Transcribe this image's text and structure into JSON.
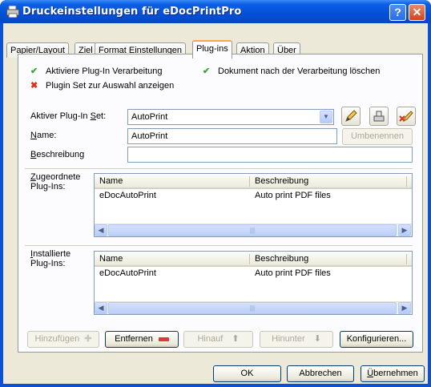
{
  "window": {
    "title": "Druckeinstellungen für eDocPrintPro",
    "help_label": "?",
    "close_label": "✕"
  },
  "tabs": [
    {
      "label": "Papier/Layout"
    },
    {
      "label": "Ziel"
    },
    {
      "label": "Format Einstellungen"
    },
    {
      "label": "Plug-ins"
    },
    {
      "label": "Aktion"
    },
    {
      "label": "Über"
    }
  ],
  "active_tab": "Plug-ins",
  "options": {
    "activate_plugin": {
      "label": "Aktiviere Plug-In Verarbeitung",
      "state": "checked"
    },
    "delete_document": {
      "label": "Dokument nach der Verarbeitung löschen",
      "state": "checked"
    },
    "show_plugin_set": {
      "label": "Plugin Set zur Auswahl anzeigen",
      "state": "unchecked"
    }
  },
  "plugin_set": {
    "label_pre": "Aktiver Plug-In ",
    "label_u": "S",
    "label_post": "et:",
    "value": "AutoPrint"
  },
  "name_field": {
    "label_u": "N",
    "label_post": "ame:",
    "value": "AutoPrint",
    "rename_label": "Umbenennen"
  },
  "description_field": {
    "label_u": "B",
    "label_post": "eschreibung",
    "value": ""
  },
  "assigned": {
    "label_u": "Z",
    "label_line1": "ugeordnete",
    "label_line2": "Plug-Ins:",
    "columns": [
      "Name",
      "Beschreibung"
    ],
    "rows": [
      {
        "name": "eDocAutoPrint",
        "description": "Auto print PDF files"
      }
    ]
  },
  "installed": {
    "label_u": "I",
    "label_line1": "nstallierte",
    "label_line2": "Plug-Ins:",
    "columns": [
      "Name",
      "Beschreibung"
    ],
    "rows": [
      {
        "name": "eDocAutoPrint",
        "description": "Auto print PDF files"
      }
    ]
  },
  "action_buttons": {
    "add": "Hinzufügen",
    "remove": "Entfernen",
    "up": "Hinauf",
    "down": "Hinunter",
    "configure": "Konfigurieren..."
  },
  "dialog_buttons": {
    "ok": "OK",
    "cancel": "Abbrechen",
    "apply_u": "Ü",
    "apply_post": "bernehmen"
  },
  "scroll_arrows": {
    "left": "◀",
    "right": "▶",
    "thumb": "|||"
  }
}
